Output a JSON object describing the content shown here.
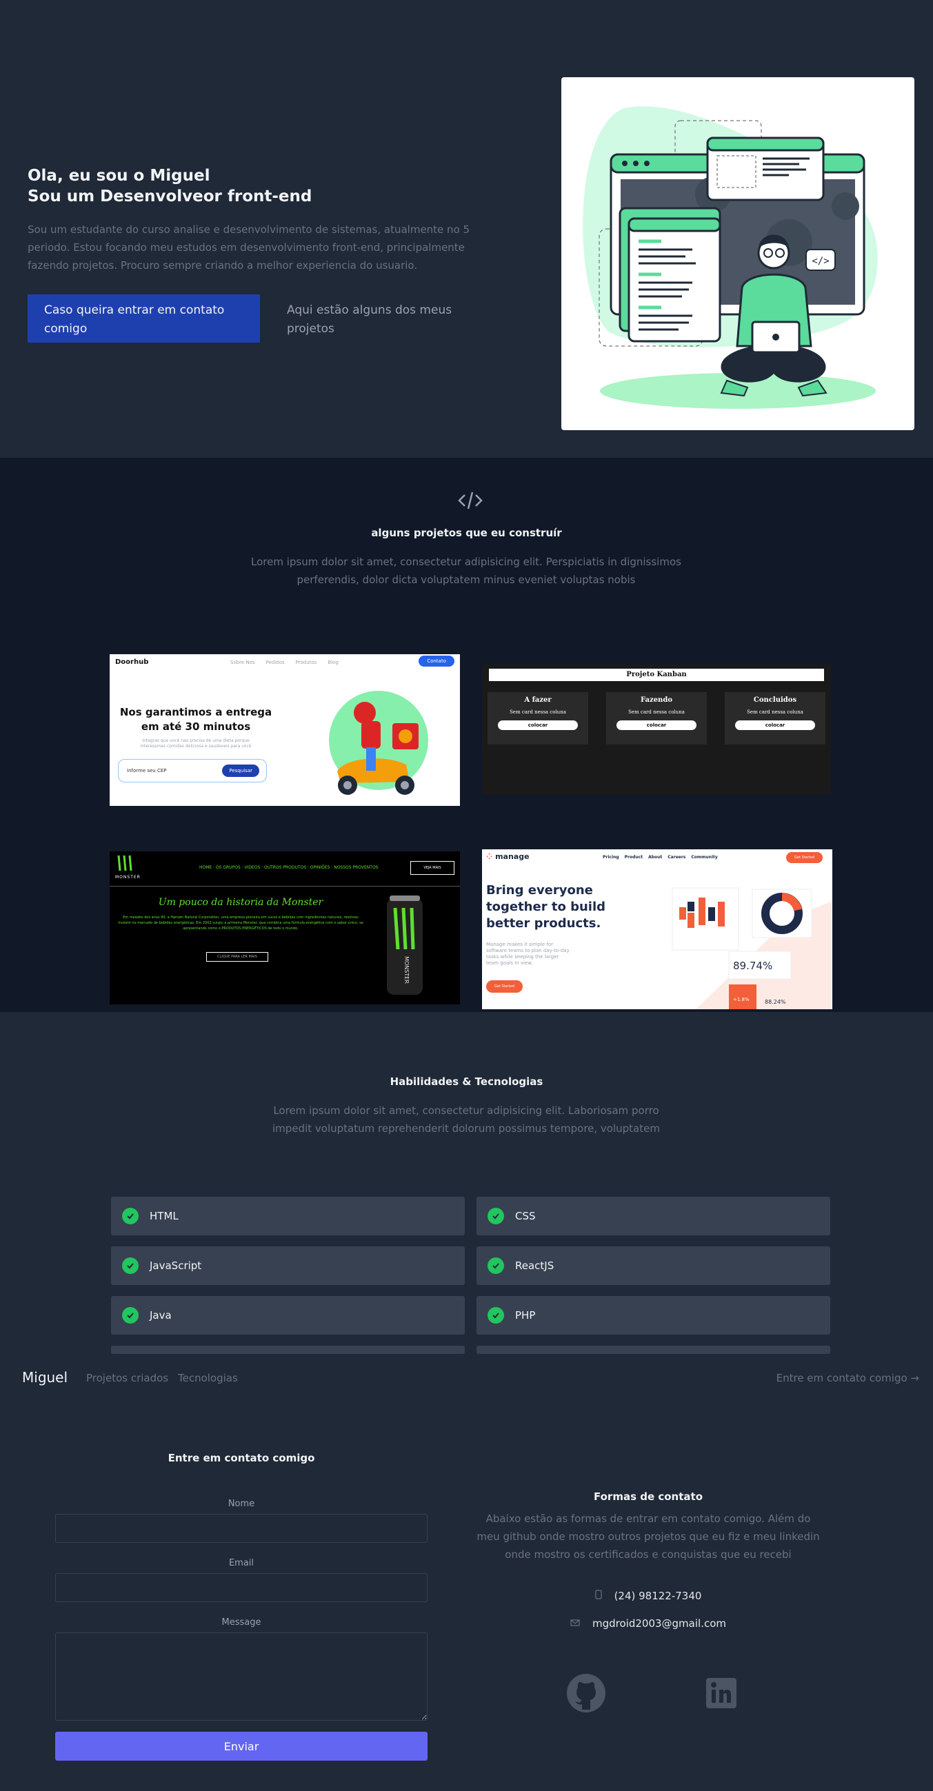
{
  "hero": {
    "title_line1": "Ola, eu sou o Miguel",
    "title_line2": "Sou um Desenvolveor front-end",
    "description": "Sou um estudante do curso analise e desenvolvimento de sistemas, atualmente no 5 periodo. Estou focando meu estudos em desenvolvimento front-end, principalmente fazendo projetos. Procuro sempre criando a melhor experiencia do usuario.",
    "contact_button": "Caso queira entrar em contato comigo",
    "projects_button": "Aqui estão alguns dos meus projetos",
    "illustration_code_tag": "</>"
  },
  "projects": {
    "icon": "code-icon",
    "title": "alguns projetos que eu construír",
    "description": "Lorem ipsum dolor sit amet, consectetur adipisicing elit. Perspiciatis in dignissimos perferendis, dolor dicta voluptatem minus eveniet voluptas nobis",
    "doorhub": {
      "logo": "Doorhub",
      "nav": [
        "Sobre Nos",
        "Pedidos",
        "Produtos",
        "Blog"
      ],
      "cta": "Contato",
      "headline1": "Nos garantimos a entrega",
      "headline2": "em até 30 minutos",
      "sub": "Integras que você nao precisa de uma dieta porque interessmas comidas deliciosa e saudaveis para você",
      "input_placeholder": "Informe seu CEP",
      "search": "Pesquisar"
    },
    "kanban": {
      "title": "Projeto Kanban",
      "columns": [
        {
          "title": "A fazer",
          "empty": "Sem card nessa coluna",
          "button": "colocar"
        },
        {
          "title": "Fazendo",
          "empty": "Sem card nessa coluna",
          "button": "colocar"
        },
        {
          "title": "Concluidos",
          "empty": "Sem card nessa coluna",
          "button": "colocar"
        }
      ]
    },
    "monster": {
      "logo": "MONSTER",
      "nav": "HOME · OS GRUPOS · VIDEOS · OUTROS PRODUTOS · OPINIÕES · NOSSOS PROVENTOS",
      "cta": "VEJA MAIS",
      "headline": "Um pouco da historia da Monster",
      "body": "Em meados dos anos 90, a Hansen Natural Corporation, uma empresa pioneira em sucos e bebidas com ingredientes naturais, resolveu investir no mercado de bebidas energéticas. Em 2002 surgiu a primeira Monster, que combina uma fórmula energética com o sabor único, se apresentando como o PRODUTOS ENERGÉTICOS de todo o mundo.",
      "button": "CLIQUE PARA LER MAIS",
      "can_text": "MONSTER"
    },
    "manage": {
      "logo": "manage",
      "nav": [
        "Pricing",
        "Product",
        "About",
        "Careers",
        "Community"
      ],
      "cta": "Get Started",
      "headline1": "Bring everyone",
      "headline2": "together to build",
      "headline3": "better products.",
      "sub": "Manage makes it simple for software teams to plan day-to-day tasks while keeping the larger team goals in view.",
      "button": "Get Started",
      "stat": "89.74%",
      "stat2": "+1.8%",
      "stat3": "88.24%"
    }
  },
  "skills": {
    "title": "Habilidades & Tecnologias",
    "description": "Lorem ipsum dolor sit amet, consectetur adipisicing elit. Laboriosam porro impedit voluptatum reprehenderit dolorum possimus tempore, voluptatem",
    "items": [
      "HTML",
      "CSS",
      "JavaScript",
      "ReactJS",
      "Java",
      "PHP"
    ]
  },
  "nav": {
    "brand": "Miguel",
    "links": [
      "Projetos criados",
      "Tecnologias"
    ],
    "cta": "Entre em contato comigo →"
  },
  "contact": {
    "form_title": "Entre em contato comigo",
    "name_label": "Nome",
    "email_label": "Email",
    "message_label": "Message",
    "submit": "Enviar",
    "ways_title": "Formas de contato",
    "ways_description": "Abaixo estão as formas de entrar em contato comigo. Além do meu github onde mostro outros projetos que eu fiz e meu linkedin onde mostro os certificados e conquistas que eu recebi",
    "phone": "(24) 98122-7340",
    "email": "mgdroid2003@gmail.com",
    "social": [
      "github-icon",
      "linkedin-icon"
    ]
  },
  "colors": {
    "bg": "#1f2937",
    "bg_dark": "#111827",
    "primary": "#1e40af",
    "accent": "#6366f1",
    "check": "#22c55e",
    "illustration_green": "#5bdb9c"
  }
}
